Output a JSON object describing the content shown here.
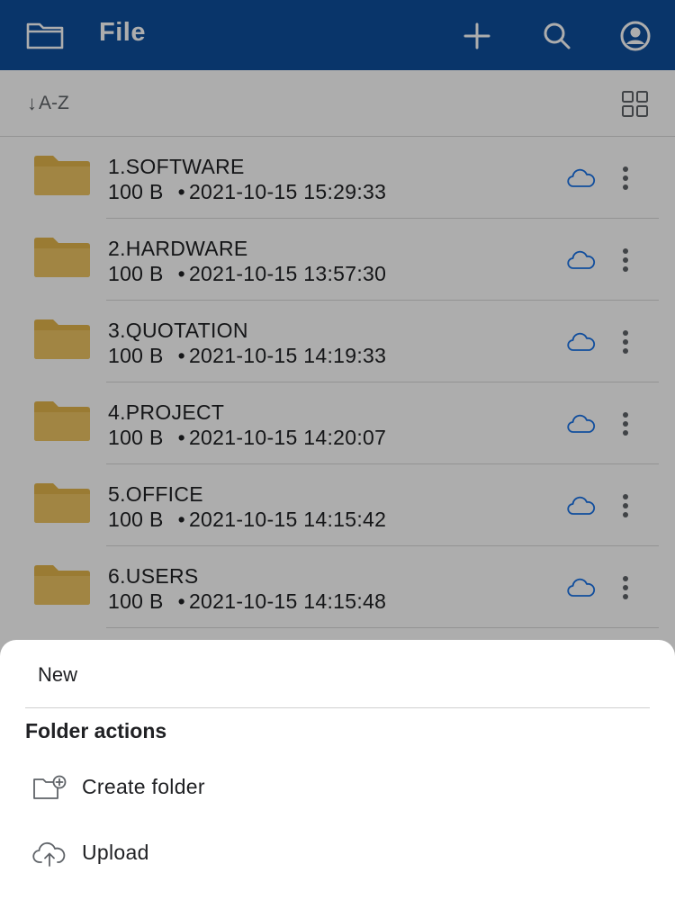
{
  "appbar": {
    "title": "File",
    "icons": {
      "folder": "folder-icon",
      "add": "plus-icon",
      "search": "search-icon",
      "account": "account-circle-icon"
    }
  },
  "sortbar": {
    "arrow": "↓",
    "label": "A-Z",
    "view_toggle_icon": "grid-view-icon"
  },
  "files": [
    {
      "name": "1.SOFTWARE",
      "size": "100 B",
      "date": "2021-10-15 15:29:33"
    },
    {
      "name": "2.HARDWARE",
      "size": "100 B",
      "date": "2021-10-15 13:57:30"
    },
    {
      "name": "3.QUOTATION",
      "size": "100 B",
      "date": "2021-10-15 14:19:33"
    },
    {
      "name": "4.PROJECT",
      "size": "100 B",
      "date": "2021-10-15 14:20:07"
    },
    {
      "name": "5.OFFICE",
      "size": "100 B",
      "date": "2021-10-15 14:15:42"
    },
    {
      "name": "6.USERS",
      "size": "100 B",
      "date": "2021-10-15 14:15:48"
    }
  ],
  "meta_separator": "•",
  "sheet": {
    "title": "New",
    "section": "Folder actions",
    "actions": [
      {
        "label": "Create folder",
        "icon": "create-folder-icon"
      },
      {
        "label": "Upload",
        "icon": "cloud-upload-icon"
      }
    ]
  },
  "colors": {
    "appbar": "#0e4f9c",
    "folder": "#e3b54c",
    "cloud": "#1a73e8",
    "scrim": "rgba(0,0,0,0.32)"
  }
}
